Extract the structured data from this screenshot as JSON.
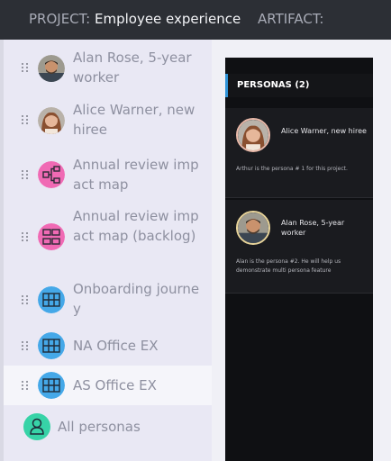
{
  "header": {
    "project_label": "PROJECT:",
    "project_name": "Employee experience",
    "artifact_label": "ARTIFACT:"
  },
  "sidebar": {
    "items": [
      {
        "label": "Alan Rose, 5-year worker",
        "icon": "alan-rose-avatar"
      },
      {
        "label": "Alice Warner, new hiree",
        "icon": "alice-warner-avatar"
      },
      {
        "label": "Annual review impact map",
        "icon": "impact-map-icon"
      },
      {
        "label": "Annual review impact map (backlog)",
        "icon": "backlog-grid-icon"
      },
      {
        "label": "Onboarding journey",
        "icon": "journey-grid-icon"
      },
      {
        "label": "NA Office EX",
        "icon": "journey-grid-icon"
      },
      {
        "label": "AS Office EX",
        "icon": "journey-grid-icon"
      }
    ],
    "all_personas": {
      "label": "All personas",
      "icon": "person-icon"
    }
  },
  "panel": {
    "header": "PERSONAS (2)",
    "cards": [
      {
        "name": "Alice Warner, new hiree",
        "description": "Arthur is the persona # 1 for this project."
      },
      {
        "name": "Alan Rose, 5-year worker",
        "description": "Alan is the persona #2. He will help us demonstrate multi persona feature"
      }
    ]
  },
  "colors": {
    "topbar_bg": "#2c2f35",
    "sidebar_bg": "#e9e8f4",
    "pink_icon": "#f06ab4",
    "blue_icon": "#45a8e8",
    "teal_icon": "#37d3a7",
    "panel_bg": "#0f1013",
    "accent_bar": "#2f93d8"
  }
}
